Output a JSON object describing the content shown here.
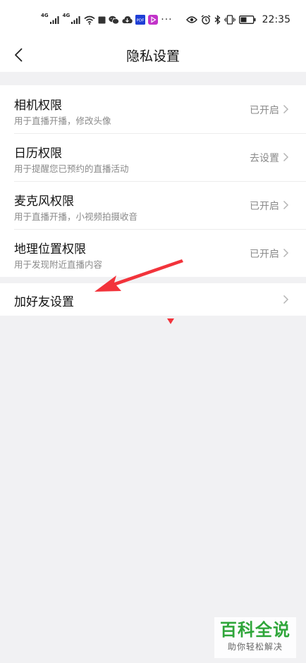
{
  "status_bar": {
    "network_1": "4G",
    "network_2": "4G",
    "app_badge": "PDF",
    "more": "···",
    "time": "22:35"
  },
  "header": {
    "title": "隐私设置"
  },
  "permissions": [
    {
      "title": "相机权限",
      "subtitle": "用于直播开播，修改头像",
      "status": "已开启"
    },
    {
      "title": "日历权限",
      "subtitle": "用于提醒您已预约的直播活动",
      "status": "去设置"
    },
    {
      "title": "麦克风权限",
      "subtitle": "用于直播开播，小视频拍摄收音",
      "status": "已开启"
    },
    {
      "title": "地理位置权限",
      "subtitle": "用于发现附近直播内容",
      "status": "已开启"
    }
  ],
  "friend_settings": {
    "title": "加好友设置"
  },
  "watermark": {
    "main": "百科全说",
    "sub": "助你轻松解决"
  },
  "colors": {
    "background": "#f1f1f3",
    "card": "#ffffff",
    "primary_text": "#111111",
    "secondary_text": "#8a8a8a",
    "annotation_arrow": "#f2333b",
    "watermark_green": "#2fa63a"
  },
  "icons": [
    "signal-icon",
    "wifi-icon",
    "stop-icon",
    "wechat-icon",
    "cloud-icon",
    "pdf-icon",
    "play-icon",
    "eye-icon",
    "alarm-icon",
    "bluetooth-icon",
    "vibrate-icon",
    "battery-icon",
    "back-arrow-icon",
    "chevron-right-icon"
  ]
}
